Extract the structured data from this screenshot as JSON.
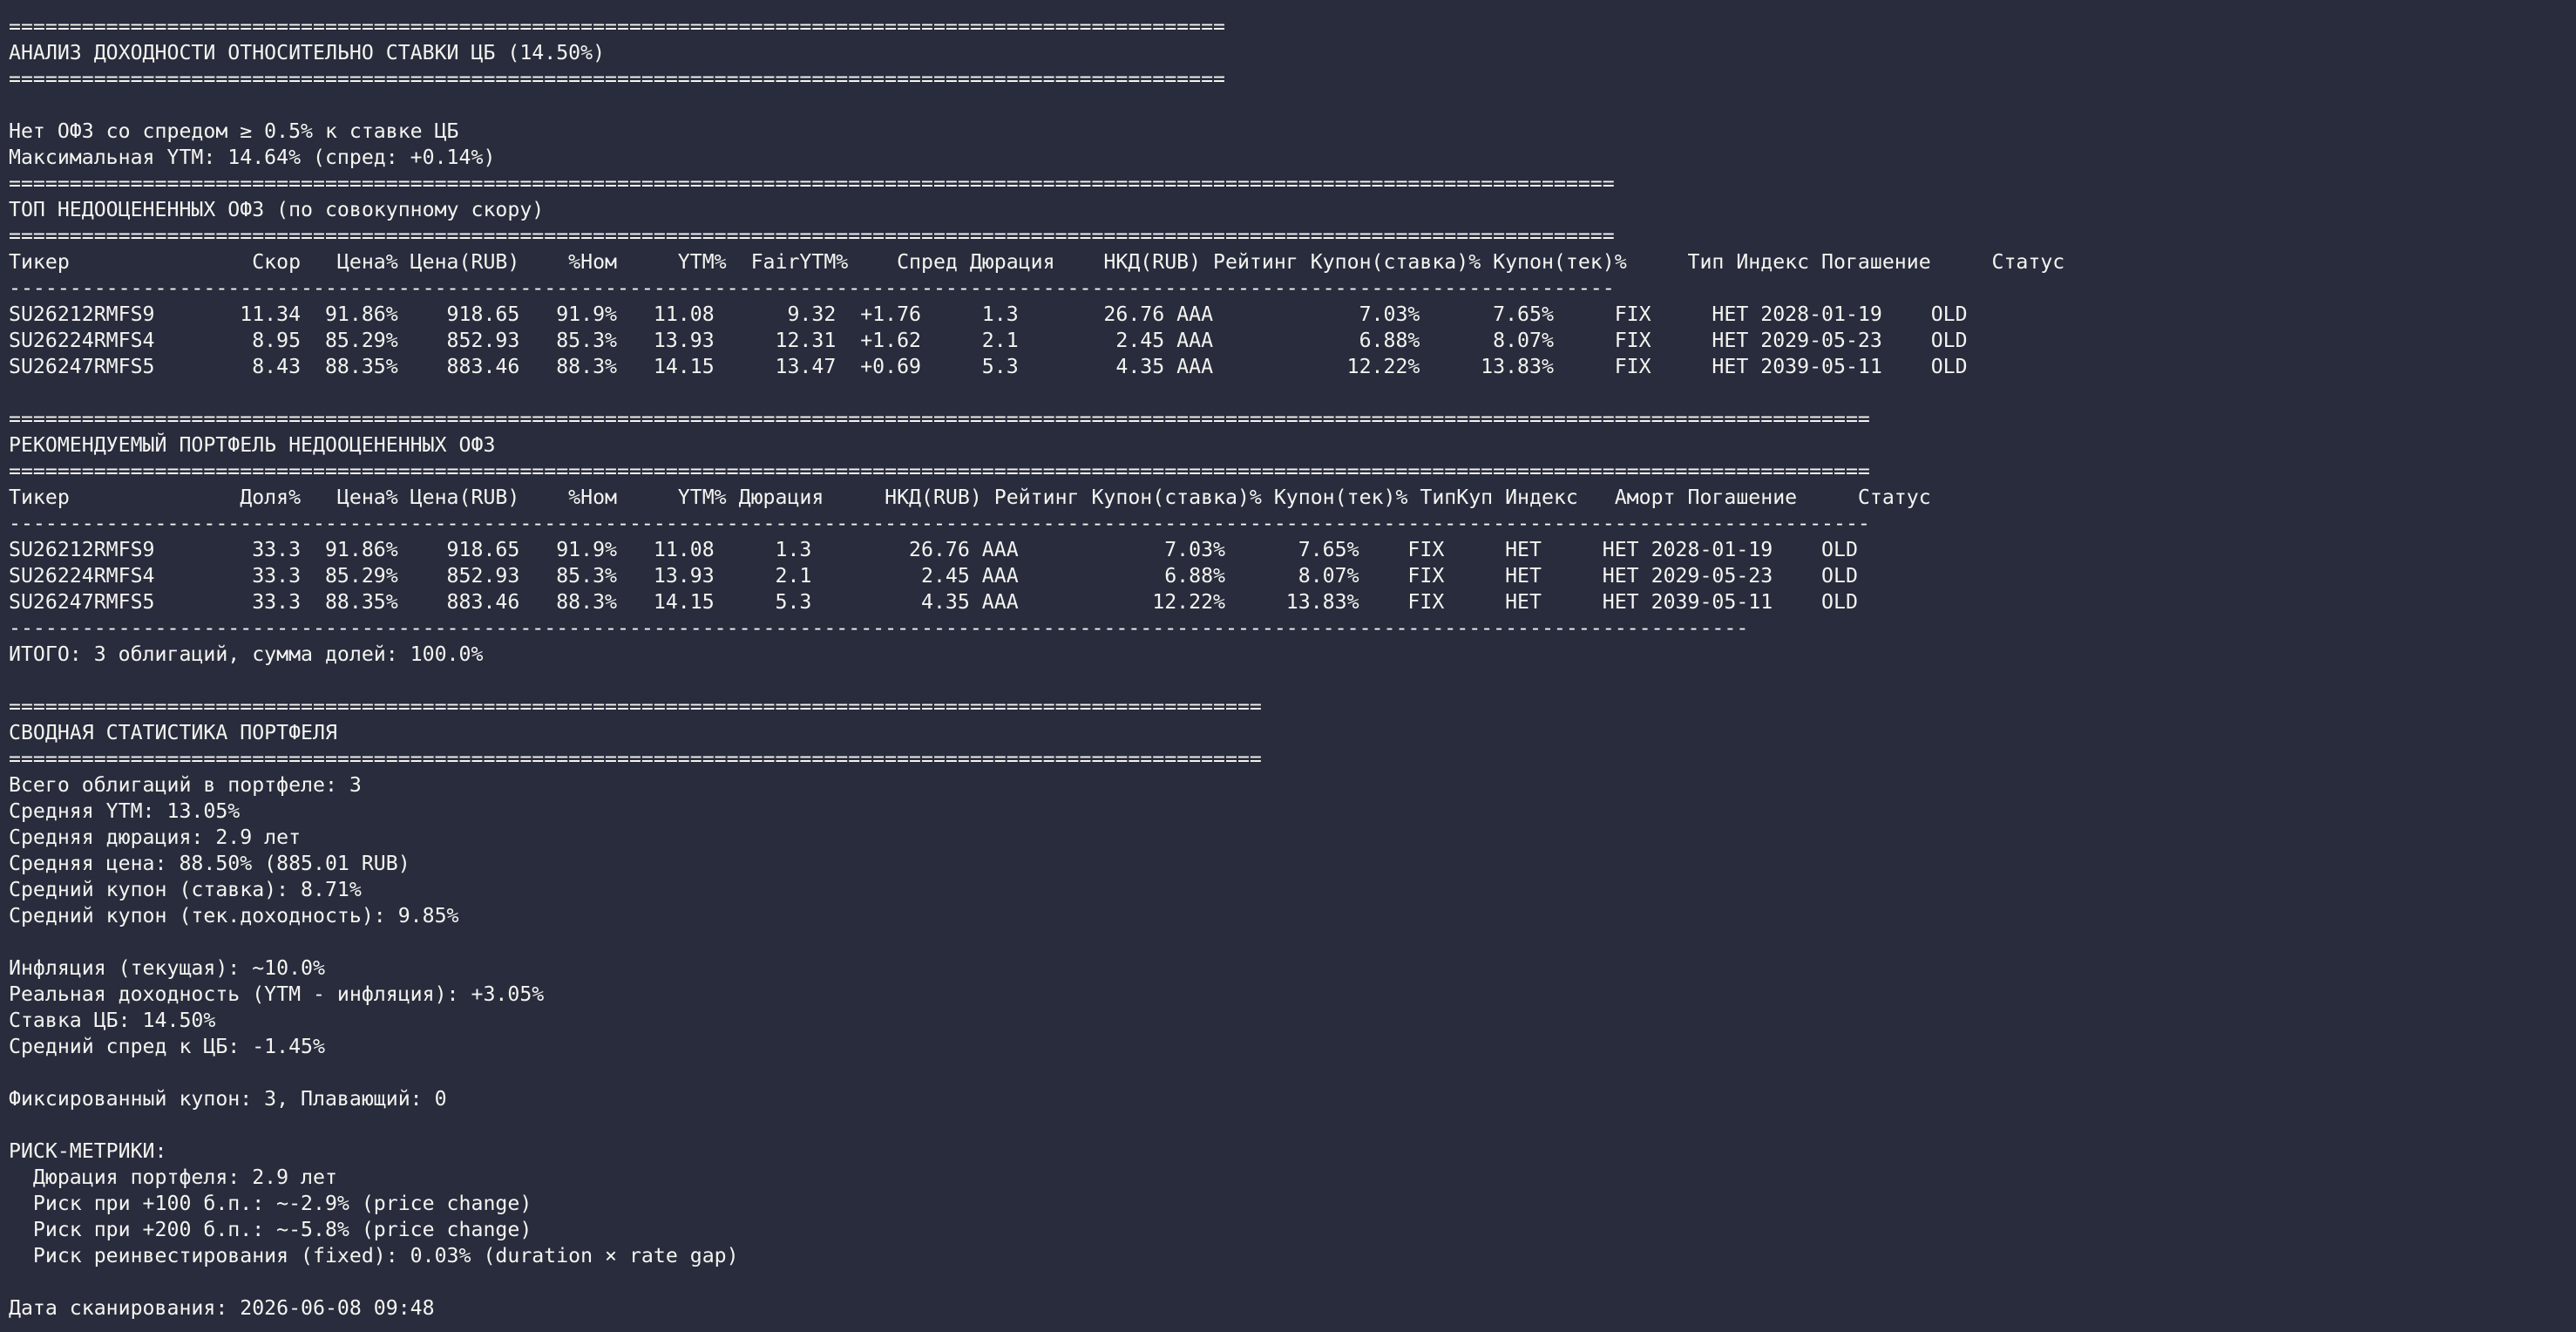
{
  "terminal": {
    "lines": [
      "====================================================================================================",
      "АНАЛИЗ ДОХОДНОСТИ ОТНОСИТЕЛЬНО СТАВКИ ЦБ (14.50%)",
      "====================================================================================================",
      "",
      "Нет ОФЗ со спредом ≥ 0.5% к ставке ЦБ",
      "Максимальная YTM: 14.64% (спред: +0.14%)",
      "====================================================================================================================================",
      "ТОП НЕДООЦЕНЕННЫХ ОФЗ (по совокупному скору)",
      "====================================================================================================================================",
      "Тикер               Скор   Цена% Цена(RUB)    %Ном     YTM%  FairYTM%    Спред Дюрация    НКД(RUB) Рейтинг Купон(ставка)% Купон(тек)%     Тип Индекс Погашение     Статус",
      "------------------------------------------------------------------------------------------------------------------------------------",
      "SU26212RMFS9       11.34  91.86%    918.65   91.9%   11.08      9.32  +1.76     1.3       26.76 AAA            7.03%      7.65%     FIX     НЕТ 2028-01-19    OLD",
      "SU26224RMFS4        8.95  85.29%    852.93   85.3%   13.93     12.31  +1.62     2.1        2.45 AAA            6.88%      8.07%     FIX     НЕТ 2029-05-23    OLD",
      "SU26247RMFS5        8.43  88.35%    883.46   88.3%   14.15     13.47  +0.69     5.3        4.35 AAA           12.22%     13.83%     FIX     НЕТ 2039-05-11    OLD",
      "",
      "=========================================================================================================================================================",
      "РЕКОМЕНДУЕМЫЙ ПОРТФЕЛЬ НЕДООЦЕНЕННЫХ ОФЗ",
      "=========================================================================================================================================================",
      "Тикер              Доля%   Цена% Цена(RUB)    %Ном     YTM% Дюрация     НКД(RUB) Рейтинг Купон(ставка)% Купон(тек)% ТипКуп Индекс   Аморт Погашение     Статус",
      "---------------------------------------------------------------------------------------------------------------------------------------------------------",
      "SU26212RMFS9        33.3  91.86%    918.65   91.9%   11.08     1.3        26.76 AAA            7.03%      7.65%    FIX     НЕТ     НЕТ 2028-01-19    OLD",
      "SU26224RMFS4        33.3  85.29%    852.93   85.3%   13.93     2.1         2.45 AAA            6.88%      8.07%    FIX     НЕТ     НЕТ 2029-05-23    OLD",
      "SU26247RMFS5        33.3  88.35%    883.46   88.3%   14.15     5.3         4.35 AAA           12.22%     13.83%    FIX     НЕТ     НЕТ 2039-05-11    OLD",
      "-----------------------------------------------------------------------------------------------------------------------------------------------",
      "ИТОГО: 3 облигаций, сумма долей: 100.0%",
      "",
      "=======================================================================================================",
      "СВОДНАЯ СТАТИСТИКА ПОРТФЕЛЯ",
      "=======================================================================================================",
      "Всего облигаций в портфеле: 3",
      "Средняя YTM: 13.05%",
      "Средняя дюрация: 2.9 лет",
      "Средняя цена: 88.50% (885.01 RUB)",
      "Средний купон (ставка): 8.71%",
      "Средний купон (тек.доходность): 9.85%",
      "",
      "Инфляция (текущая): ~10.0%",
      "Реальная доходность (YTM - инфляция): +3.05%",
      "Ставка ЦБ: 14.50%",
      "Средний спред к ЦБ: -1.45%",
      "",
      "Фиксированный купон: 3, Плавающий: 0",
      "",
      "РИСК-МЕТРИКИ:",
      "  Дюрация портфеля: 2.9 лет",
      "  Риск при +100 б.п.: ~-2.9% (price change)",
      "  Риск при +200 б.п.: ~-5.8% (price change)",
      "  Риск реинвестирования (fixed): 0.03% (duration × rate gap)",
      "",
      "Дата сканирования: 2026-06-08 09:48"
    ]
  }
}
